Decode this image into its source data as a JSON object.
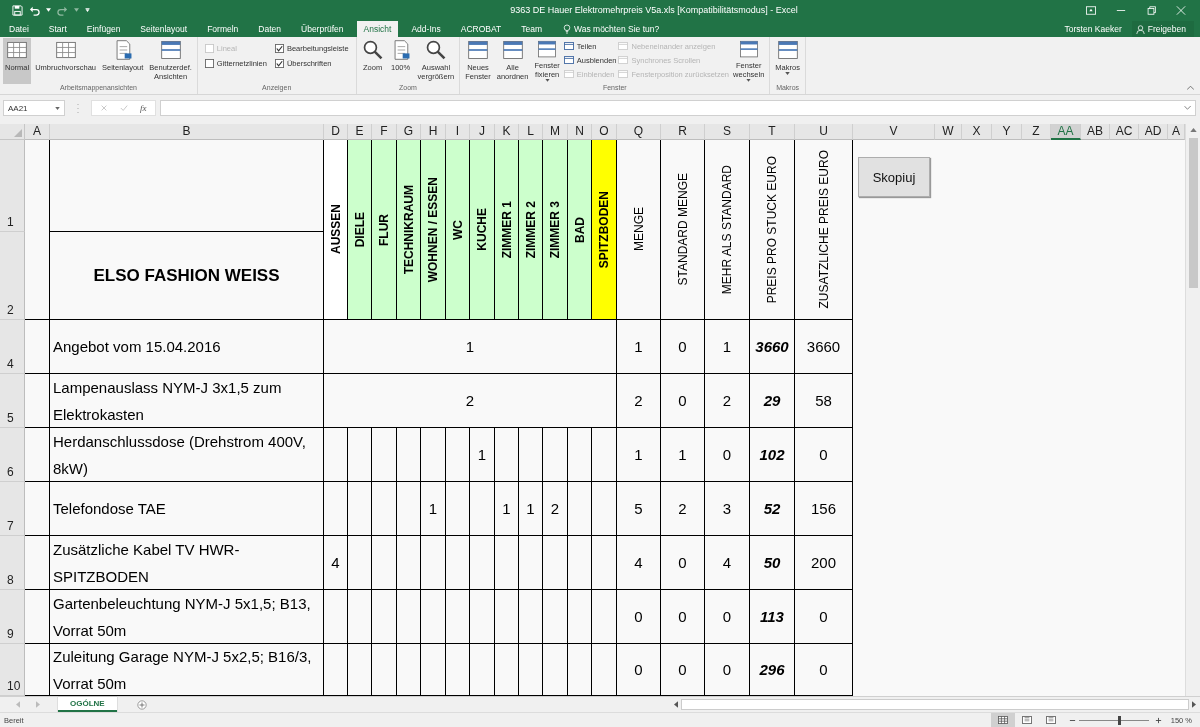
{
  "title_bar": {
    "title": "9363 DE Hauer Elektromehrpreis V5a.xls  [Kompatibilitätsmodus] - Excel",
    "user": "Torsten Kaeker",
    "share": "Freigeben"
  },
  "tabs": [
    {
      "label": "Datei",
      "selected": false
    },
    {
      "label": "Start",
      "selected": false
    },
    {
      "label": "Einfügen",
      "selected": false
    },
    {
      "label": "Seitenlayout",
      "selected": false
    },
    {
      "label": "Formeln",
      "selected": false
    },
    {
      "label": "Daten",
      "selected": false
    },
    {
      "label": "Überprüfen",
      "selected": false
    },
    {
      "label": "Ansicht",
      "selected": true
    },
    {
      "label": "Add-Ins",
      "selected": false
    },
    {
      "label": "ACROBAT",
      "selected": false
    },
    {
      "label": "Team",
      "selected": false
    }
  ],
  "tell_me": {
    "placeholder": "Was möchten Sie tun?"
  },
  "ribbon": {
    "groups": [
      {
        "label": "Arbeitsmappenansichten",
        "items": [
          {
            "kind": "view",
            "label": "Normal",
            "selected": true
          },
          {
            "kind": "view",
            "label": "Umbruchvorschau",
            "selected": false
          },
          {
            "kind": "view",
            "label": "Seitenlayout",
            "selected": false
          },
          {
            "kind": "view",
            "label": "Benutzerdef.\nAnsichten",
            "selected": false
          }
        ]
      },
      {
        "label": "Anzeigen",
        "items": [
          {
            "kind": "checkbox",
            "label": "Lineal",
            "checked": false,
            "disabled": true
          },
          {
            "kind": "checkbox",
            "label": "Bearbeitungsleiste",
            "checked": true,
            "disabled": false
          },
          {
            "kind": "checkbox",
            "label": "Gitternetzlinien",
            "checked": false,
            "disabled": false
          },
          {
            "kind": "checkbox",
            "label": "Überschriften",
            "checked": true,
            "disabled": false
          }
        ]
      },
      {
        "label": "Zoom",
        "items": [
          {
            "kind": "large",
            "label": "Zoom"
          },
          {
            "kind": "large",
            "label": "100%"
          },
          {
            "kind": "large",
            "label": "Auswahl\nvergrößern"
          }
        ]
      },
      {
        "label": "Fenster",
        "items": [
          {
            "kind": "large",
            "label": "Neues\nFenster"
          },
          {
            "kind": "large",
            "label": "Alle\nanordnen"
          },
          {
            "kind": "menu",
            "label": "Fenster\nfixieren"
          },
          {
            "kind": "stack",
            "items": [
              {
                "label": "Teilen",
                "disabled": false
              },
              {
                "label": "Ausblenden",
                "disabled": false
              },
              {
                "label": "Einblenden",
                "disabled": true
              }
            ]
          },
          {
            "kind": "stack",
            "items": [
              {
                "label": "Nebeneinander anzeigen",
                "disabled": true
              },
              {
                "label": "Synchrones Scrollen",
                "disabled": true
              },
              {
                "label": "Fensterposition zurücksetzen",
                "disabled": true
              }
            ]
          },
          {
            "kind": "menu",
            "label": "Fenster\nwechseln"
          }
        ]
      },
      {
        "label": "Makros",
        "items": [
          {
            "kind": "menu",
            "label": "Makros"
          }
        ]
      }
    ]
  },
  "formula_bar": {
    "name_box": "AA21",
    "function_label": "fx"
  },
  "sheet": {
    "columns": [
      {
        "letter": "A",
        "selected": false
      },
      {
        "letter": "B",
        "selected": false
      },
      {
        "letter": "D",
        "selected": false
      },
      {
        "letter": "E",
        "selected": false
      },
      {
        "letter": "F",
        "selected": false
      },
      {
        "letter": "G",
        "selected": false
      },
      {
        "letter": "H",
        "selected": false
      },
      {
        "letter": "I",
        "selected": false
      },
      {
        "letter": "J",
        "selected": false
      },
      {
        "letter": "K",
        "selected": false
      },
      {
        "letter": "L",
        "selected": false
      },
      {
        "letter": "M",
        "selected": false
      },
      {
        "letter": "N",
        "selected": false
      },
      {
        "letter": "O",
        "selected": false
      },
      {
        "letter": "Q",
        "selected": false
      },
      {
        "letter": "R",
        "selected": false
      },
      {
        "letter": "S",
        "selected": false
      },
      {
        "letter": "T",
        "selected": false
      },
      {
        "letter": "U",
        "selected": false
      },
      {
        "letter": "V",
        "selected": false
      },
      {
        "letter": "W",
        "selected": false
      },
      {
        "letter": "X",
        "selected": false
      },
      {
        "letter": "Y",
        "selected": false
      },
      {
        "letter": "Z",
        "selected": false
      },
      {
        "letter": "AA",
        "selected": true
      },
      {
        "letter": "AB",
        "selected": false
      },
      {
        "letter": "AC",
        "selected": false
      },
      {
        "letter": "AD",
        "selected": false
      },
      {
        "letter": "A",
        "selected": false
      }
    ],
    "header_rows": [
      "1",
      "2"
    ],
    "title": "ELSO FASHION WEISS",
    "rooms": [
      {
        "label": "AUSSEN",
        "color": "#ffffff"
      },
      {
        "label": "DIELE",
        "color": "#ccffcc"
      },
      {
        "label": "FLUR",
        "color": "#ccffcc"
      },
      {
        "label": "TECHNIKRAUM",
        "color": "#ccffcc"
      },
      {
        "label": "WOHNEN / ESSEN",
        "color": "#ccffcc"
      },
      {
        "label": "WC",
        "color": "#ccffcc"
      },
      {
        "label": "KUCHE",
        "color": "#ccffcc"
      },
      {
        "label": "ZIMMER 1",
        "color": "#ccffcc"
      },
      {
        "label": "ZIMMER 2",
        "color": "#ccffcc"
      },
      {
        "label": "ZIMMER 3",
        "color": "#ccffcc"
      },
      {
        "label": "BAD",
        "color": "#ccffcc"
      },
      {
        "label": "SPITZBODEN",
        "color": "#ffff00"
      }
    ],
    "metrics": [
      "MENGE",
      "STANDARD MENGE",
      "MEHR ALS STANDARD",
      "PREIS PRO STUCK EURO",
      "ZUSATZLICHE PREIS EURO"
    ],
    "rows": [
      {
        "number": "4",
        "description": "Angebot vom 15.04.2016",
        "kind": "merged",
        "value": "1",
        "metrics": [
          "1",
          "0",
          "1",
          "3660",
          "3660"
        ]
      },
      {
        "number": "5",
        "description": "Lampenauslass NYM-J 3x1,5 zum Elektrokasten",
        "kind": "merged",
        "value": "2",
        "metrics": [
          "2",
          "0",
          "2",
          "29",
          "58"
        ]
      },
      {
        "number": "6",
        "description": "Herdanschlussdose (Drehstrom 400V, 8kW)",
        "kind": "split",
        "cells": [
          null,
          null,
          null,
          null,
          null,
          null,
          "1",
          null,
          null,
          null,
          null,
          null
        ],
        "metrics": [
          "1",
          "1",
          "0",
          "102",
          "0"
        ]
      },
      {
        "number": "7",
        "description": "Telefondose TAE",
        "kind": "split",
        "cells": [
          null,
          null,
          null,
          null,
          "1",
          null,
          null,
          "1",
          "1",
          "2",
          null,
          null
        ],
        "metrics": [
          "5",
          "2",
          "3",
          "52",
          "156"
        ]
      },
      {
        "number": "8",
        "description": "Zusätzliche Kabel TV  HWR-SPITZBODEN",
        "kind": "split",
        "cells": [
          "4",
          null,
          null,
          null,
          null,
          null,
          null,
          null,
          null,
          null,
          null,
          null
        ],
        "metrics": [
          "4",
          "0",
          "4",
          "50",
          "200"
        ]
      },
      {
        "number": "9",
        "description": "Gartenbeleuchtung NYM-J 5x1,5; B13, Vorrat 50m",
        "kind": "split",
        "cells": [
          null,
          null,
          null,
          null,
          null,
          null,
          null,
          null,
          null,
          null,
          null,
          null
        ],
        "metrics": [
          "0",
          "0",
          "0",
          "113",
          "0"
        ]
      },
      {
        "number": "10",
        "description": "Zuleitung Garage NYM-J 5x2,5; B16/3, Vorrat 50m",
        "kind": "split",
        "cells": [
          null,
          null,
          null,
          null,
          null,
          null,
          null,
          null,
          null,
          null,
          null,
          null
        ],
        "metrics": [
          "0",
          "0",
          "0",
          "296",
          "0"
        ]
      }
    ],
    "macro_button": "Skopiuj"
  },
  "sheet_tabs": [
    {
      "label": "OGÓLNE",
      "selected": true
    }
  ],
  "status_bar": {
    "text": "Bereit",
    "views": [
      {
        "selected": true
      },
      {
        "selected": false
      },
      {
        "selected": false
      }
    ],
    "zoom_slider": {
      "level": 0.57
    },
    "zoom": "150 %"
  }
}
